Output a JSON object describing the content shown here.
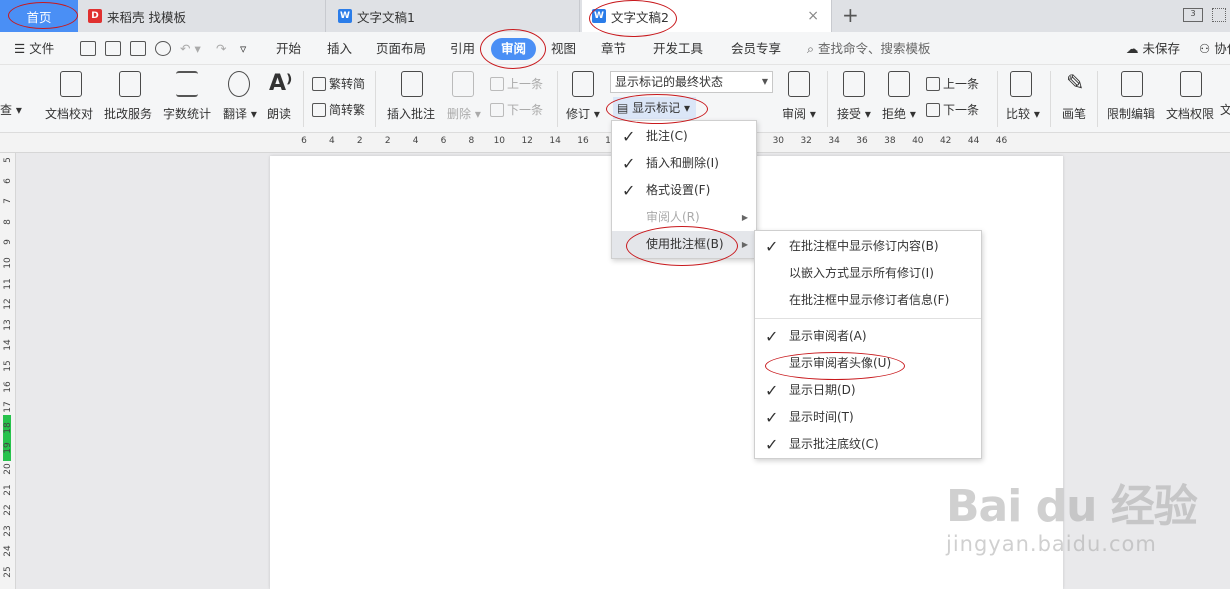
{
  "tabs": {
    "home": "首页",
    "template": "来稻壳 找模板",
    "doc1": "文字文稿1",
    "doc2": "文字文稿2",
    "close": "×",
    "plus": "+",
    "win_badge": "3"
  },
  "menubar": {
    "file": "文件",
    "items": [
      "开始",
      "插入",
      "页面布局",
      "引用",
      "审阅",
      "视图",
      "章节",
      "开发工具",
      "会员专享"
    ],
    "active": "审阅",
    "search": "查找命令、搜索模板",
    "unsaved": "未保存",
    "collab": "协作"
  },
  "ribbon": {
    "check": "查",
    "proofread": "文档校对",
    "correction": "批改服务",
    "wordcount": "字数统计",
    "translate": "翻译",
    "read_aloud": "朗读",
    "trad_to_simp": "繁转简",
    "simp_to_trad": "简转繁",
    "insert_comment": "插入批注",
    "delete": "删除",
    "prev_comment": "上一条",
    "next_comment": "下一条",
    "track": "修订",
    "final_state": "显示标记的最终状态",
    "show_markup": "显示标记",
    "review": "审阅",
    "accept": "接受",
    "reject": "拒绝",
    "prev": "上一条",
    "next": "下一条",
    "compare": "比较",
    "pen": "画笔",
    "restrict": "限制编辑",
    "permission": "文档权限",
    "more": "文"
  },
  "ruler": {
    "h_ticks": [
      "6",
      "4",
      "2",
      "2",
      "4",
      "6",
      "8",
      "10",
      "12",
      "14",
      "16",
      "18",
      "20",
      "22",
      "24",
      "26",
      "28",
      "30",
      "32",
      "34",
      "36",
      "38",
      "40",
      "42",
      "44",
      "46"
    ],
    "v_ticks": [
      "5",
      "6",
      "7",
      "8",
      "9",
      "10",
      "11",
      "12",
      "13",
      "14",
      "15",
      "16",
      "17",
      "18",
      "19",
      "20",
      "21",
      "22",
      "23",
      "24",
      "25"
    ]
  },
  "show_markup_menu": [
    {
      "label": "批注(C)",
      "checked": true
    },
    {
      "label": "插入和删除(I)",
      "checked": true
    },
    {
      "label": "格式设置(F)",
      "checked": true
    },
    {
      "label": "审阅人(R)",
      "checked": false,
      "disabled": true,
      "submenu": true
    },
    {
      "label": "使用批注框(B)",
      "checked": false,
      "submenu": true,
      "highlighted": true
    }
  ],
  "balloon_menu": [
    {
      "label": "在批注框中显示修订内容(B)",
      "checked": true
    },
    {
      "label": "以嵌入方式显示所有修订(I)",
      "checked": false
    },
    {
      "label": "在批注框中显示修订者信息(F)",
      "checked": false
    },
    {
      "label": "显示审阅者(A)",
      "checked": true
    },
    {
      "label": "显示审阅者头像(U)",
      "checked": false
    },
    {
      "label": "显示日期(D)",
      "checked": true
    },
    {
      "label": "显示时间(T)",
      "checked": true
    },
    {
      "label": "显示批注底纹(C)",
      "checked": true
    }
  ],
  "watermark": {
    "logo": "Bai du 经验",
    "url": "jingyan.baidu.com"
  },
  "colors": {
    "accent": "#4a8ff5",
    "annotation": "#c8191d",
    "green_marker": "#27c24c"
  }
}
